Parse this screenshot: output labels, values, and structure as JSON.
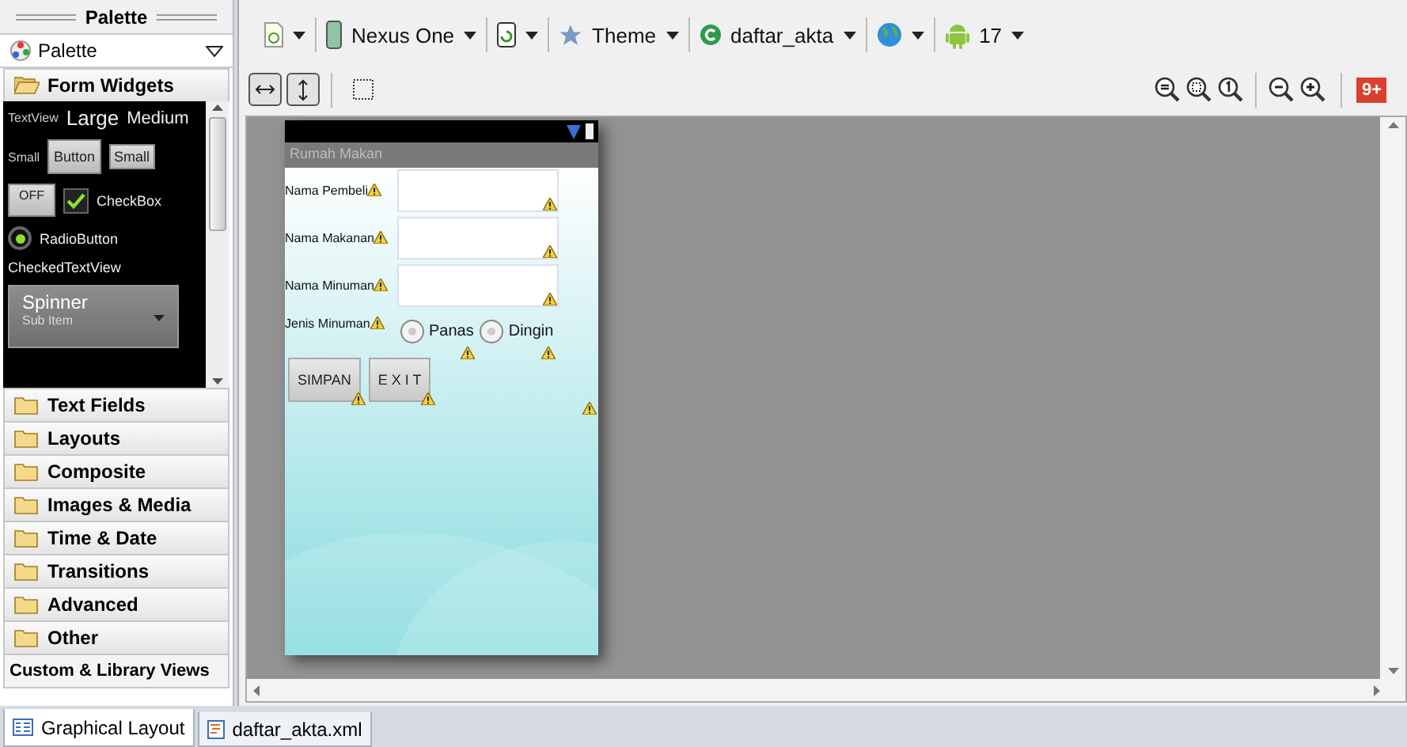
{
  "palette": {
    "title": "Palette",
    "selector": "Palette",
    "open_category": {
      "label": "Form Widgets",
      "expanded": true
    },
    "preview": {
      "textview": "TextView",
      "large": "Large",
      "medium": "Medium",
      "small_label": "Small",
      "button": "Button",
      "small_button": "Small",
      "toggle": "OFF",
      "checkbox": {
        "label": "CheckBox",
        "checked": true
      },
      "radio": {
        "label": "RadioButton",
        "selected": true
      },
      "checked_textview": "CheckedTextView",
      "spinner": "Spinner",
      "spinner_sub": "Sub Item"
    },
    "categories": [
      {
        "label": "Text Fields",
        "expanded": false
      },
      {
        "label": "Layouts",
        "expanded": false
      },
      {
        "label": "Composite",
        "expanded": false
      },
      {
        "label": "Images & Media",
        "expanded": false
      },
      {
        "label": "Time & Date",
        "expanded": false
      },
      {
        "label": "Transitions",
        "expanded": false
      },
      {
        "label": "Advanced",
        "expanded": false
      },
      {
        "label": "Other",
        "expanded": false
      }
    ],
    "custom": "Custom & Library Views"
  },
  "toolbar": [
    {
      "kind": "config"
    },
    {
      "kind": "device",
      "label": "Nexus One"
    },
    {
      "kind": "rotate"
    },
    {
      "kind": "theme",
      "label": "Theme"
    },
    {
      "kind": "activity",
      "label": "daftar_akta"
    },
    {
      "kind": "locale"
    },
    {
      "kind": "api",
      "label": "17"
    }
  ],
  "layout_toggles": [
    {
      "kind": "horizontal",
      "selected": true
    },
    {
      "kind": "vertical",
      "selected": true
    },
    {
      "kind": "bounds",
      "selected": false
    }
  ],
  "zoom_controls": [
    {
      "kind": "fit"
    },
    {
      "kind": "real"
    },
    {
      "kind": "actual"
    },
    {
      "kind": "out"
    },
    {
      "kind": "in"
    }
  ],
  "issues_badge": "9+",
  "phone": {
    "title": "Rumah Makan",
    "fields": [
      {
        "label": "Nama Pembeli"
      },
      {
        "label": "Nama Makanan"
      },
      {
        "label": "Nama Minuman"
      }
    ],
    "radio_label": "Jenis Minuman",
    "radios": [
      {
        "label": "Panas",
        "selected": false
      },
      {
        "label": "Dingin",
        "selected": false
      }
    ],
    "buttons": [
      "SIMPAN",
      "E X I T"
    ]
  },
  "editor_tabs": [
    {
      "label": "Graphical Layout",
      "selected": true
    },
    {
      "label": "daftar_akta.xml",
      "selected": false
    }
  ]
}
